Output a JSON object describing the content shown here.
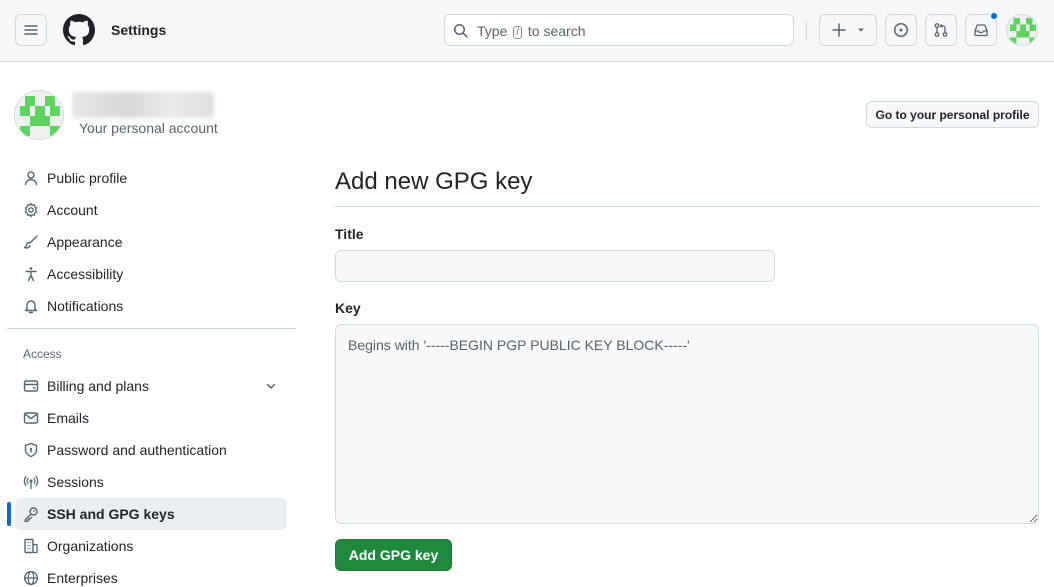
{
  "header": {
    "title": "Settings",
    "search": {
      "prefix": "Type",
      "key": "/",
      "suffix": "to search"
    }
  },
  "account": {
    "subtitle": "Your personal account",
    "profile_button": "Go to your personal profile"
  },
  "sidebar": {
    "items": [
      {
        "label": "Public profile",
        "icon": "person-icon"
      },
      {
        "label": "Account",
        "icon": "gear-icon"
      },
      {
        "label": "Appearance",
        "icon": "paintbrush-icon"
      },
      {
        "label": "Accessibility",
        "icon": "accessibility-icon"
      },
      {
        "label": "Notifications",
        "icon": "bell-icon"
      }
    ],
    "access_heading": "Access",
    "access_items": [
      {
        "label": "Billing and plans",
        "icon": "credit-card-icon"
      },
      {
        "label": "Emails",
        "icon": "mail-icon"
      },
      {
        "label": "Password and authentication",
        "icon": "shield-lock-icon"
      },
      {
        "label": "Sessions",
        "icon": "broadcast-icon"
      },
      {
        "label": "SSH and GPG keys",
        "icon": "key-icon",
        "active": true
      },
      {
        "label": "Organizations",
        "icon": "organization-icon"
      },
      {
        "label": "Enterprises",
        "icon": "globe-icon"
      }
    ]
  },
  "main": {
    "title": "Add new GPG key",
    "title_label": "Title",
    "title_value": "",
    "key_label": "Key",
    "key_value": "",
    "key_placeholder": "Begins with '-----BEGIN PGP PUBLIC KEY BLOCK-----'",
    "submit_label": "Add GPG key"
  },
  "colors": {
    "accent": "#0969da",
    "primary_button": "#1f883d",
    "avatar_green": "#5fd35f"
  }
}
